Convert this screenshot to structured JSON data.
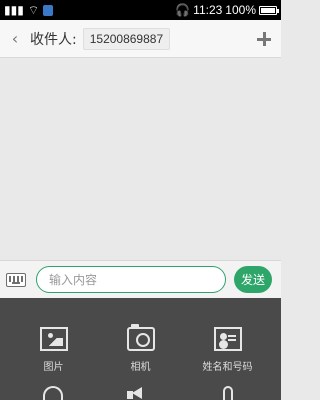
{
  "status_bar": {
    "time": "11:23",
    "battery": "100%"
  },
  "header": {
    "recipient_label": "收件人:",
    "recipient_number": "15200869887"
  },
  "compose": {
    "placeholder": "输入内容",
    "send_label": "发送"
  },
  "attachments": [
    {
      "label": "图片",
      "icon": "image-icon"
    },
    {
      "label": "相机",
      "icon": "camera-icon"
    },
    {
      "label": "姓名和号码",
      "icon": "contact-card-icon"
    }
  ],
  "partial_icons": [
    "alarm-clock-icon",
    "speaker-icon",
    "microphone-icon"
  ],
  "colors": {
    "accent_green": "#2ea66a",
    "attach_panel": "#4a4a4a",
    "status_bar": "#000000"
  }
}
